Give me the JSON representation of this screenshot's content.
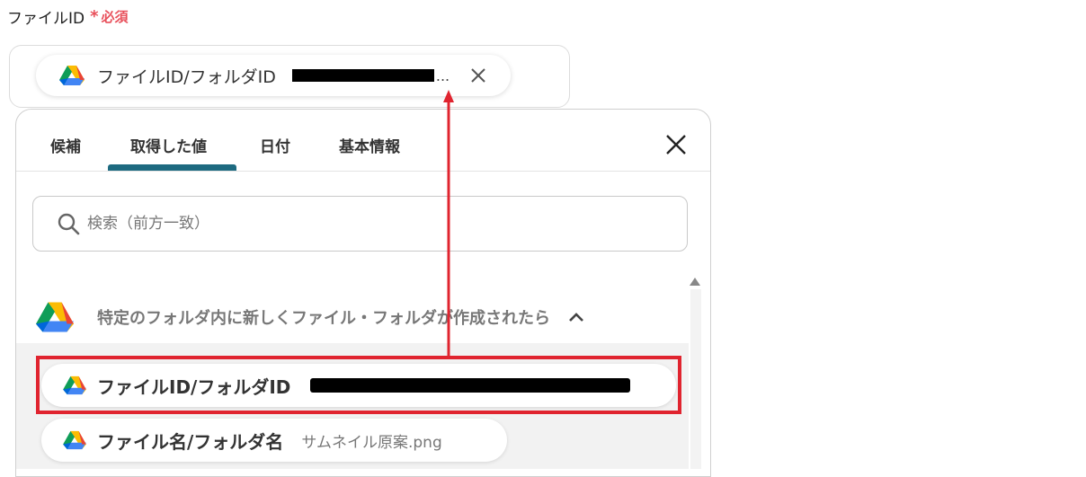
{
  "field": {
    "label": "ファイルID",
    "required_mark": "*",
    "required_text": "必須"
  },
  "selected_chip": {
    "label": "ファイルID/フォルダID",
    "ellipsis": "...",
    "icon": "google-drive-icon"
  },
  "panel": {
    "tabs": [
      {
        "label": "候補"
      },
      {
        "label": "取得した値",
        "active": true
      },
      {
        "label": "日付"
      },
      {
        "label": "基本情報"
      }
    ],
    "search": {
      "placeholder": "検索（前方一致）"
    },
    "group": {
      "title": "特定のフォルダ内に新しくファイル・フォルダが作成されたら",
      "icon": "google-drive-icon"
    },
    "items": [
      {
        "label": "ファイルID/フォルダID",
        "value": ""
      },
      {
        "label": "ファイル名/フォルダ名",
        "value": "サムネイル原案.png"
      }
    ]
  },
  "colors": {
    "required": "#e8505b",
    "tab_active_underline": "#1d6a80",
    "highlight": "#e0242f"
  }
}
